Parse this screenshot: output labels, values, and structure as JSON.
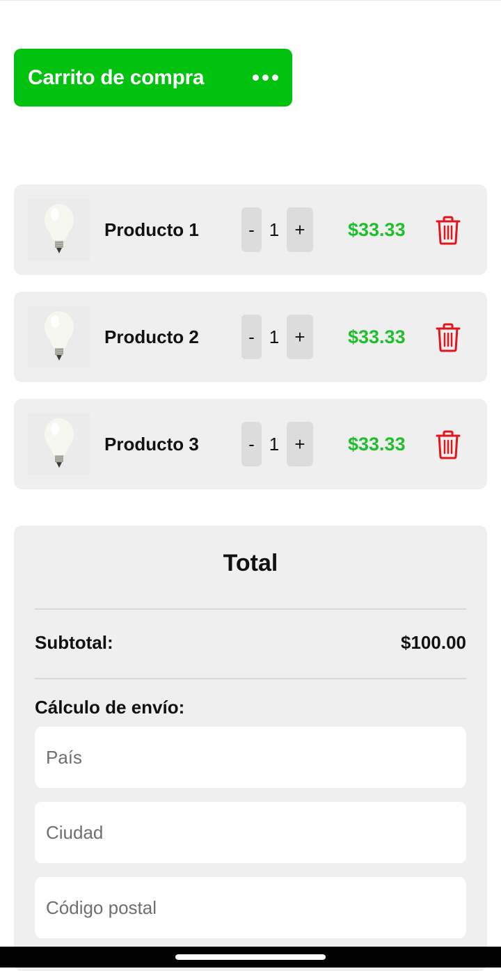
{
  "header": {
    "title": "Carrito de compra",
    "menu_icon": "more-horizontal-icon",
    "color": "#00c20f"
  },
  "cart": {
    "items": [
      {
        "name": "Producto 1",
        "quantity": "1",
        "price": "$33.33",
        "image_icon": "light-bulb-icon"
      },
      {
        "name": "Producto 2",
        "quantity": "1",
        "price": "$33.33",
        "image_icon": "light-bulb-icon"
      },
      {
        "name": "Producto 3",
        "quantity": "1",
        "price": "$33.33",
        "image_icon": "light-bulb-icon"
      }
    ],
    "decrement_label": "-",
    "increment_label": "+",
    "remove_icon": "trash-icon",
    "price_color": "#1fbf2c",
    "remove_color": "#e0161c"
  },
  "summary": {
    "title": "Total",
    "subtotal_label": "Subtotal:",
    "subtotal_value": "$100.00",
    "shipping_label": "Cálculo de envío:",
    "country_placeholder": "País",
    "city_placeholder": "Ciudad",
    "postal_placeholder": "Código postal"
  }
}
